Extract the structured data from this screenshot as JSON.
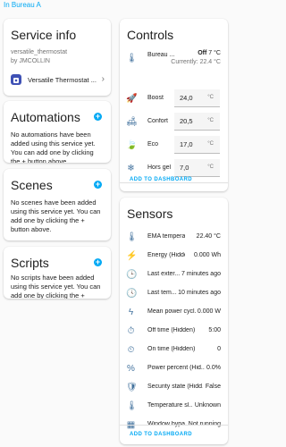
{
  "breadcrumb": "In Bureau A",
  "service_info": {
    "title": "Service info",
    "service_id": "versatile_thermostat",
    "author": "by JMCOLLIN",
    "device_name": "Versatile Thermostat ..."
  },
  "automations": {
    "title": "Automations",
    "text": "No automations have been added using this service yet. You can add one by clicking the + button above."
  },
  "scenes": {
    "title": "Scenes",
    "text": "No scenes have been added using this service yet. You can add one by clicking the + button above."
  },
  "scripts": {
    "title": "Scripts",
    "text": "No scripts have been added using this service yet. You can add one by clicking the + button above."
  },
  "controls": {
    "title": "Controls",
    "climate": {
      "name": "Bureau ...",
      "state": "Off",
      "target": "7 °C",
      "current": "Currently: 22.4 °C"
    },
    "numbers": [
      {
        "name": "Boost",
        "value": "24,0",
        "unit": "°C",
        "icon": "rocket-icon"
      },
      {
        "name": "Confort",
        "value": "20,5",
        "unit": "°C",
        "icon": "sofa-icon"
      },
      {
        "name": "Eco",
        "value": "17,0",
        "unit": "°C",
        "icon": "leaf-icon"
      },
      {
        "name": "Hors gel",
        "value": "7,0",
        "unit": "°C",
        "icon": "snowflake-icon"
      }
    ],
    "add_to_dashboard": "ADD TO DASHBOARD"
  },
  "sensors": {
    "title": "Sensors",
    "rows": [
      {
        "name": "EMA temperatur...",
        "value": "22.40 °C",
        "icon": "thermometer-icon"
      },
      {
        "name": "Energy (Hidden)",
        "value": "0.000 Wh",
        "icon": "lightning-icon"
      },
      {
        "name": "Last exter...",
        "value": "7 minutes ago",
        "icon": "clock-icon"
      },
      {
        "name": "Last tem...",
        "value": "10 minutes ago",
        "icon": "clock-icon"
      },
      {
        "name": "Mean power cycl...",
        "value": "0.000 W",
        "icon": "flash-icon"
      },
      {
        "name": "Off time (Hidden)",
        "value": "5:00",
        "icon": "timer-off-icon"
      },
      {
        "name": "On time (Hidden)",
        "value": "0",
        "icon": "timer-icon"
      },
      {
        "name": "Power percent (Hid...",
        "value": "0.0%",
        "icon": "percent-icon"
      },
      {
        "name": "Security state (Hidd...",
        "value": "False",
        "icon": "shield-icon"
      },
      {
        "name": "Temperature sl...",
        "value": "Unknown",
        "icon": "thermometer-icon"
      },
      {
        "name": "Window bypa...",
        "value": "Not running",
        "icon": "window-icon"
      }
    ],
    "add_to_dashboard": "ADD TO DASHBOARD"
  },
  "colors": {
    "accent": "#03a9f4",
    "icon": "#44739e",
    "background": "#fafafa"
  }
}
